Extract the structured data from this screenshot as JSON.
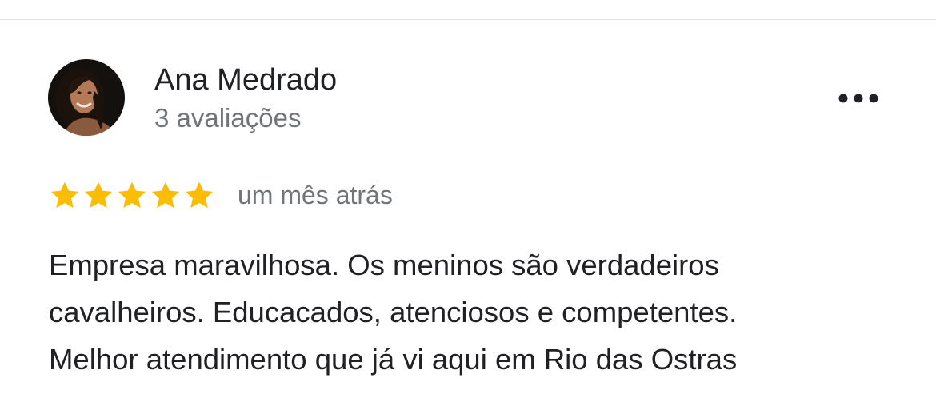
{
  "reviewer": {
    "name": "Ana Medrado",
    "review_count": "3 avaliações",
    "avatar_icon": "profile-photo"
  },
  "actions": {
    "more_icon": "more-horizontal-icon"
  },
  "review": {
    "rating": 5,
    "rating_max": 5,
    "star_color": "#fbbc04",
    "date": "um mês atrás",
    "text_lines": [
      "Empresa maravilhosa. Os meninos são verdadeiros",
      "cavalheiros. Educacados, atenciosos e competentes.",
      "Melhor atendimento que já vi aqui em Rio das Ostras"
    ]
  }
}
